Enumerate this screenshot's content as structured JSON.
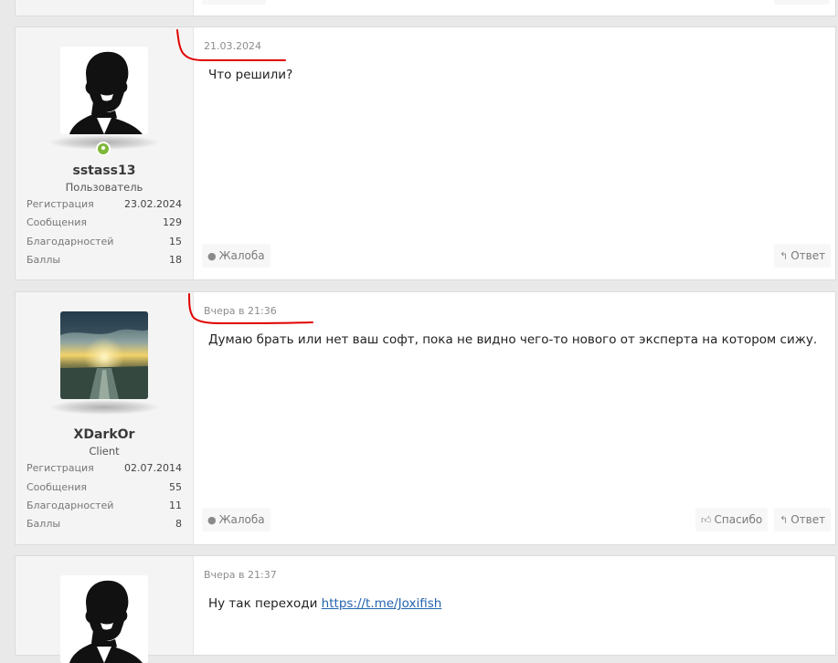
{
  "posts": [
    {
      "date": "21.03.2024",
      "text": "Что решили?",
      "user": {
        "name": "sstass13",
        "title": "Пользователь",
        "online": true,
        "stats": [
          {
            "label": "Регистрация",
            "value": "23.02.2024"
          },
          {
            "label": "Сообщения",
            "value": "129"
          },
          {
            "label": "Благодарностей",
            "value": "15"
          },
          {
            "label": "Баллы",
            "value": "18"
          }
        ]
      },
      "actions": {
        "report": "Жалоба",
        "reply": "Ответ"
      }
    },
    {
      "date": "Вчера в 21:36",
      "text": "Думаю брать или нет ваш софт, пока не видно чего-то нового от эксперта на котором сижу.",
      "user": {
        "name": "XDarkOr",
        "title": "Client",
        "online": false,
        "stats": [
          {
            "label": "Регистрация",
            "value": "02.07.2014"
          },
          {
            "label": "Сообщения",
            "value": "55"
          },
          {
            "label": "Благодарностей",
            "value": "11"
          },
          {
            "label": "Баллы",
            "value": "8"
          }
        ]
      },
      "actions": {
        "report": "Жалоба",
        "thanks": "Спасибо",
        "reply": "Ответ"
      }
    },
    {
      "date": "Вчера в 21:37",
      "text_prefix": "Ну так переходи ",
      "link": "https://t.me/Joxifish"
    }
  ],
  "icons": {
    "report": "info-circle-icon",
    "reply": "reply-arrow-icon",
    "thanks": "thumbs-up-icon",
    "online": "online-status-icon"
  },
  "colors": {
    "page_bg": "#e9e9e9",
    "userpane_bg": "#f4f4f4",
    "online": "#7fb83a",
    "link": "#2463ad",
    "annotation": "#e00000"
  }
}
